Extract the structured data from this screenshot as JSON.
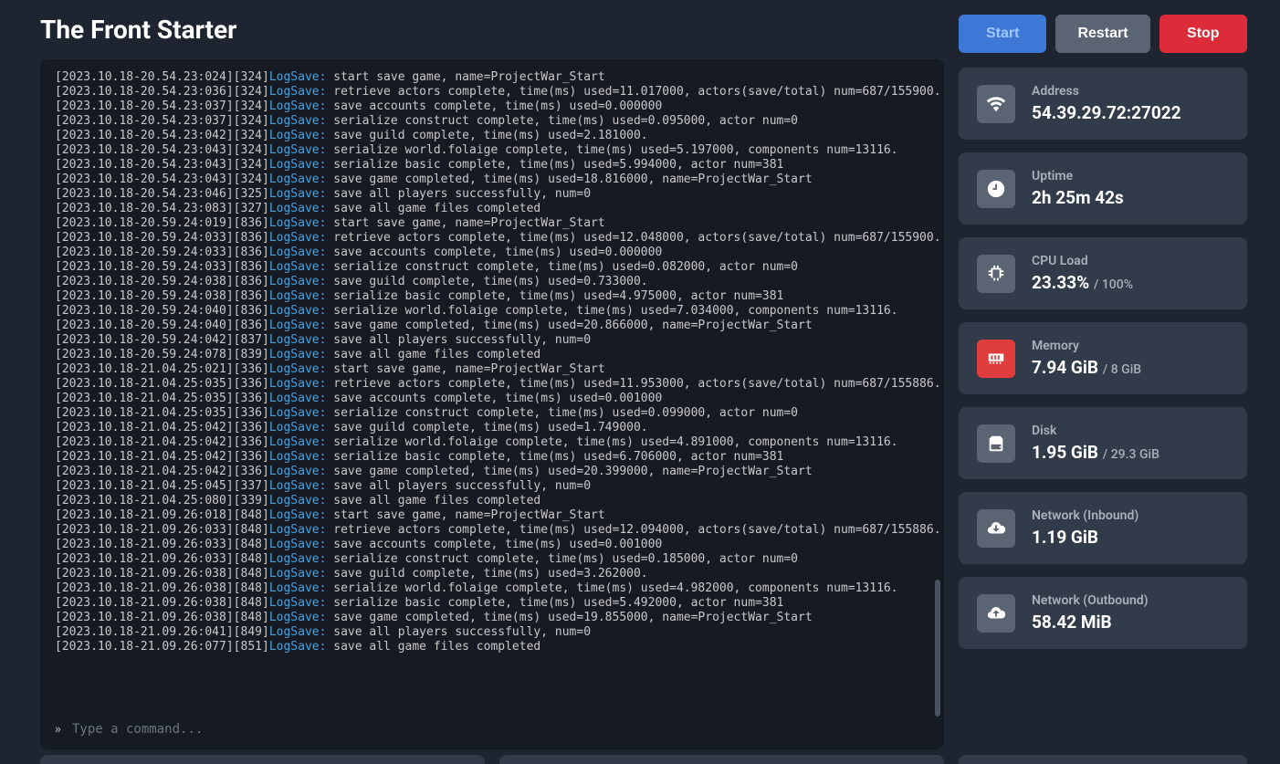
{
  "header": {
    "title": "The Front Starter",
    "start_label": "Start",
    "restart_label": "Restart",
    "stop_label": "Stop"
  },
  "console": {
    "placeholder": "Type a command...",
    "lines": [
      {
        "ts": "[2023.10.18-20.54.23:024][324]",
        "label": "LogSave:",
        "rest": " start save game, name=ProjectWar_Start"
      },
      {
        "ts": "[2023.10.18-20.54.23:036][324]",
        "label": "LogSave:",
        "rest": " retrieve actors complete, time(ms) used=11.017000, actors(save/total) num=687/155900."
      },
      {
        "ts": "[2023.10.18-20.54.23:037][324]",
        "label": "LogSave:",
        "rest": " save accounts complete, time(ms) used=0.000000"
      },
      {
        "ts": "[2023.10.18-20.54.23:037][324]",
        "label": "LogSave:",
        "rest": " serialize construct complete, time(ms) used=0.095000, actor num=0"
      },
      {
        "ts": "[2023.10.18-20.54.23:042][324]",
        "label": "LogSave:",
        "rest": " save guild complete, time(ms) used=2.181000."
      },
      {
        "ts": "[2023.10.18-20.54.23:043][324]",
        "label": "LogSave:",
        "rest": " serialize world.folaige complete, time(ms) used=5.197000, components num=13116."
      },
      {
        "ts": "[2023.10.18-20.54.23:043][324]",
        "label": "LogSave:",
        "rest": " serialize basic complete, time(ms) used=5.994000, actor num=381"
      },
      {
        "ts": "[2023.10.18-20.54.23:043][324]",
        "label": "LogSave:",
        "rest": " save game completed, time(ms) used=18.816000, name=ProjectWar_Start"
      },
      {
        "ts": "[2023.10.18-20.54.23:046][325]",
        "label": "LogSave:",
        "rest": " save all players successfully, num=0"
      },
      {
        "ts": "[2023.10.18-20.54.23:083][327]",
        "label": "LogSave:",
        "rest": " save all game files completed"
      },
      {
        "ts": "[2023.10.18-20.59.24:019][836]",
        "label": "LogSave:",
        "rest": " start save game, name=ProjectWar_Start"
      },
      {
        "ts": "[2023.10.18-20.59.24:033][836]",
        "label": "LogSave:",
        "rest": " retrieve actors complete, time(ms) used=12.048000, actors(save/total) num=687/155900."
      },
      {
        "ts": "[2023.10.18-20.59.24:033][836]",
        "label": "LogSave:",
        "rest": " save accounts complete, time(ms) used=0.000000"
      },
      {
        "ts": "[2023.10.18-20.59.24:033][836]",
        "label": "LogSave:",
        "rest": " serialize construct complete, time(ms) used=0.082000, actor num=0"
      },
      {
        "ts": "[2023.10.18-20.59.24:038][836]",
        "label": "LogSave:",
        "rest": " save guild complete, time(ms) used=0.733000."
      },
      {
        "ts": "[2023.10.18-20.59.24:038][836]",
        "label": "LogSave:",
        "rest": " serialize basic complete, time(ms) used=4.975000, actor num=381"
      },
      {
        "ts": "[2023.10.18-20.59.24:040][836]",
        "label": "LogSave:",
        "rest": " serialize world.folaige complete, time(ms) used=7.034000, components num=13116."
      },
      {
        "ts": "[2023.10.18-20.59.24:040][836]",
        "label": "LogSave:",
        "rest": " save game completed, time(ms) used=20.866000, name=ProjectWar_Start"
      },
      {
        "ts": "[2023.10.18-20.59.24:042][837]",
        "label": "LogSave:",
        "rest": " save all players successfully, num=0"
      },
      {
        "ts": "[2023.10.18-20.59.24:078][839]",
        "label": "LogSave:",
        "rest": " save all game files completed"
      },
      {
        "ts": "[2023.10.18-21.04.25:021][336]",
        "label": "LogSave:",
        "rest": " start save game, name=ProjectWar_Start"
      },
      {
        "ts": "[2023.10.18-21.04.25:035][336]",
        "label": "LogSave:",
        "rest": " retrieve actors complete, time(ms) used=11.953000, actors(save/total) num=687/155886."
      },
      {
        "ts": "[2023.10.18-21.04.25:035][336]",
        "label": "LogSave:",
        "rest": " save accounts complete, time(ms) used=0.001000"
      },
      {
        "ts": "[2023.10.18-21.04.25:035][336]",
        "label": "LogSave:",
        "rest": " serialize construct complete, time(ms) used=0.099000, actor num=0"
      },
      {
        "ts": "[2023.10.18-21.04.25:042][336]",
        "label": "LogSave:",
        "rest": " save guild complete, time(ms) used=1.749000."
      },
      {
        "ts": "[2023.10.18-21.04.25:042][336]",
        "label": "LogSave:",
        "rest": " serialize world.folaige complete, time(ms) used=4.891000, components num=13116."
      },
      {
        "ts": "[2023.10.18-21.04.25:042][336]",
        "label": "LogSave:",
        "rest": " serialize basic complete, time(ms) used=6.706000, actor num=381"
      },
      {
        "ts": "[2023.10.18-21.04.25:042][336]",
        "label": "LogSave:",
        "rest": " save game completed, time(ms) used=20.399000, name=ProjectWar_Start"
      },
      {
        "ts": "[2023.10.18-21.04.25:045][337]",
        "label": "LogSave:",
        "rest": " save all players successfully, num=0"
      },
      {
        "ts": "[2023.10.18-21.04.25:080][339]",
        "label": "LogSave:",
        "rest": " save all game files completed"
      },
      {
        "ts": "[2023.10.18-21.09.26:018][848]",
        "label": "LogSave:",
        "rest": " start save game, name=ProjectWar_Start"
      },
      {
        "ts": "[2023.10.18-21.09.26:033][848]",
        "label": "LogSave:",
        "rest": " retrieve actors complete, time(ms) used=12.094000, actors(save/total) num=687/155886."
      },
      {
        "ts": "[2023.10.18-21.09.26:033][848]",
        "label": "LogSave:",
        "rest": " save accounts complete, time(ms) used=0.001000"
      },
      {
        "ts": "[2023.10.18-21.09.26:033][848]",
        "label": "LogSave:",
        "rest": " serialize construct complete, time(ms) used=0.185000, actor num=0"
      },
      {
        "ts": "[2023.10.18-21.09.26:038][848]",
        "label": "LogSave:",
        "rest": " save guild complete, time(ms) used=3.262000."
      },
      {
        "ts": "[2023.10.18-21.09.26:038][848]",
        "label": "LogSave:",
        "rest": " serialize world.folaige complete, time(ms) used=4.982000, components num=13116."
      },
      {
        "ts": "[2023.10.18-21.09.26:038][848]",
        "label": "LogSave:",
        "rest": " serialize basic complete, time(ms) used=5.492000, actor num=381"
      },
      {
        "ts": "[2023.10.18-21.09.26:038][848]",
        "label": "LogSave:",
        "rest": " save game completed, time(ms) used=19.855000, name=ProjectWar_Start"
      },
      {
        "ts": "[2023.10.18-21.09.26:041][849]",
        "label": "LogSave:",
        "rest": " save all players successfully, num=0"
      },
      {
        "ts": "[2023.10.18-21.09.26:077][851]",
        "label": "LogSave:",
        "rest": " save all game files completed"
      }
    ]
  },
  "stats": {
    "address": {
      "label": "Address",
      "value": "54.39.29.72:27022"
    },
    "uptime": {
      "label": "Uptime",
      "value": "2h 25m 42s"
    },
    "cpu": {
      "label": "CPU Load",
      "value": "23.33%",
      "sub": "/ 100%"
    },
    "memory": {
      "label": "Memory",
      "value": "7.94 GiB",
      "sub": "/ 8 GiB"
    },
    "disk": {
      "label": "Disk",
      "value": "1.95 GiB",
      "sub": "/ 29.3 GiB"
    },
    "net_in": {
      "label": "Network (Inbound)",
      "value": "1.19 GiB"
    },
    "net_out": {
      "label": "Network (Outbound)",
      "value": "58.42 MiB"
    }
  }
}
